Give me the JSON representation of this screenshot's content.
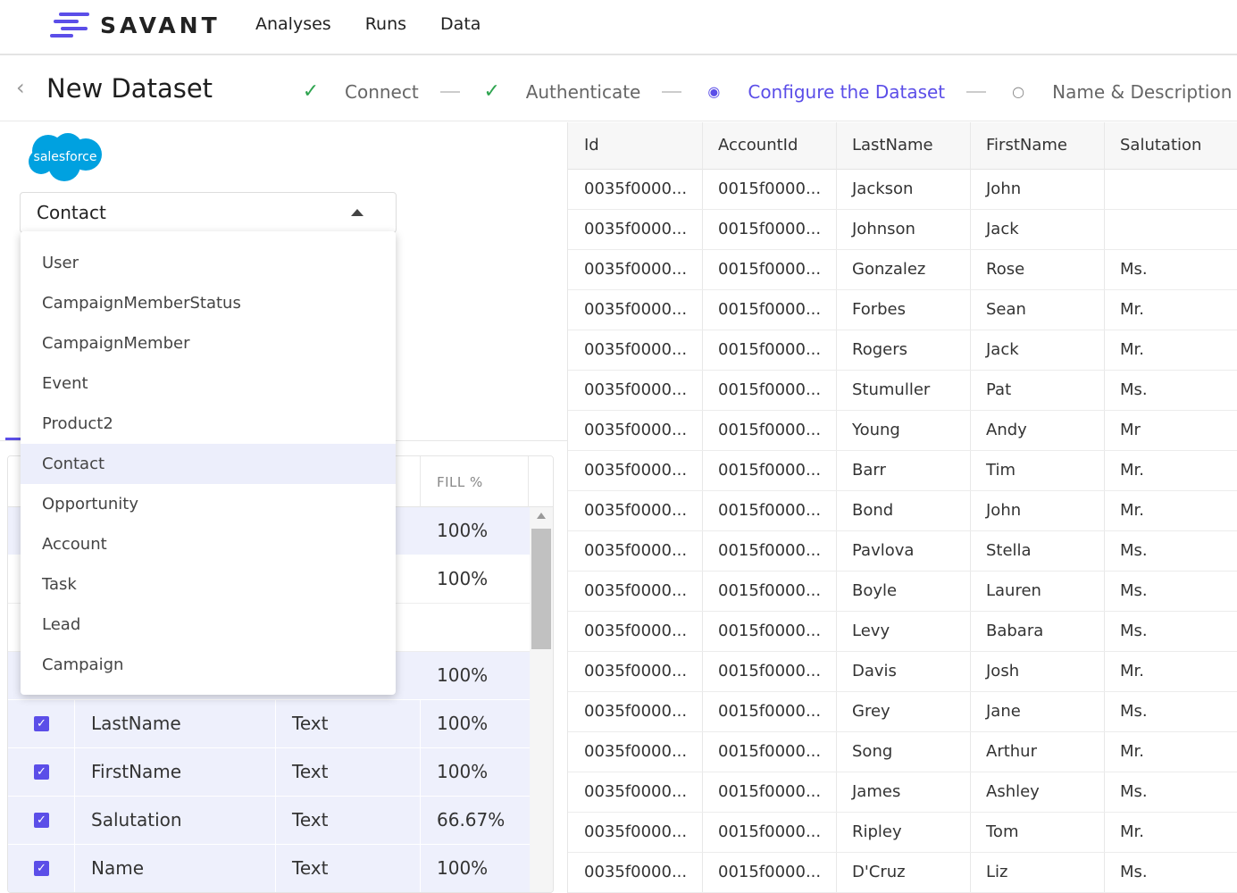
{
  "app": {
    "brand": "SAVANT",
    "nav": [
      "Analyses",
      "Runs",
      "Data"
    ]
  },
  "header": {
    "back_icon": "chevron-left-icon",
    "title": "New Dataset",
    "steps": [
      {
        "label": "Connect",
        "state": "done"
      },
      {
        "label": "Authenticate",
        "state": "done"
      },
      {
        "label": "Configure the Dataset",
        "state": "active"
      },
      {
        "label": "Name & Description",
        "state": "todo"
      }
    ]
  },
  "connector": {
    "logo_text": "salesforce",
    "object_select": {
      "value": "Contact"
    }
  },
  "dropdown": {
    "options": [
      "User",
      "CampaignMemberStatus",
      "CampaignMember",
      "Event",
      "Product2",
      "Contact",
      "Opportunity",
      "Account",
      "Task",
      "Lead",
      "Campaign"
    ],
    "selected": "Contact"
  },
  "fields_table": {
    "fill_header": "FILL %",
    "partial_rows": [
      {
        "fill": "100%"
      },
      {
        "fill": "100%"
      },
      {
        "fill": ""
      },
      {
        "fill": "100%"
      }
    ],
    "rows": [
      {
        "name": "LastName",
        "type": "Text",
        "fill": "100%"
      },
      {
        "name": "FirstName",
        "type": "Text",
        "fill": "100%"
      },
      {
        "name": "Salutation",
        "type": "Text",
        "fill": "66.67%"
      },
      {
        "name": "Name",
        "type": "Text",
        "fill": "100%"
      }
    ]
  },
  "preview": {
    "columns": [
      "Id",
      "AccountId",
      "LastName",
      "FirstName",
      "Salutation"
    ],
    "rows": [
      [
        "0035f0000...",
        "0015f0000...",
        "Jackson",
        "John",
        ""
      ],
      [
        "0035f0000...",
        "0015f0000...",
        "Johnson",
        "Jack",
        ""
      ],
      [
        "0035f0000...",
        "0015f0000...",
        "Gonzalez",
        "Rose",
        "Ms."
      ],
      [
        "0035f0000...",
        "0015f0000...",
        "Forbes",
        "Sean",
        "Mr."
      ],
      [
        "0035f0000...",
        "0015f0000...",
        "Rogers",
        "Jack",
        "Mr."
      ],
      [
        "0035f0000...",
        "0015f0000...",
        "Stumuller",
        "Pat",
        "Ms."
      ],
      [
        "0035f0000...",
        "0015f0000...",
        "Young",
        "Andy",
        "Mr"
      ],
      [
        "0035f0000...",
        "0015f0000...",
        "Barr",
        "Tim",
        "Mr."
      ],
      [
        "0035f0000...",
        "0015f0000...",
        "Bond",
        "John",
        "Mr."
      ],
      [
        "0035f0000...",
        "0015f0000...",
        "Pavlova",
        "Stella",
        "Ms."
      ],
      [
        "0035f0000...",
        "0015f0000...",
        "Boyle",
        "Lauren",
        "Ms."
      ],
      [
        "0035f0000...",
        "0015f0000...",
        "Levy",
        "Babara",
        "Ms."
      ],
      [
        "0035f0000...",
        "0015f0000...",
        "Davis",
        "Josh",
        "Mr."
      ],
      [
        "0035f0000...",
        "0015f0000...",
        "Grey",
        "Jane",
        "Ms."
      ],
      [
        "0035f0000...",
        "0015f0000...",
        "Song",
        "Arthur",
        "Mr."
      ],
      [
        "0035f0000...",
        "0015f0000...",
        "James",
        "Ashley",
        "Ms."
      ],
      [
        "0035f0000...",
        "0015f0000...",
        "Ripley",
        "Tom",
        "Mr."
      ],
      [
        "0035f0000...",
        "0015f0000...",
        "D'Cruz",
        "Liz",
        "Ms."
      ]
    ]
  },
  "colors": {
    "accent": "#5b4ee8",
    "success": "#2ea44f",
    "salesforce": "#00a1e0",
    "selected_row": "#eef0fc"
  }
}
